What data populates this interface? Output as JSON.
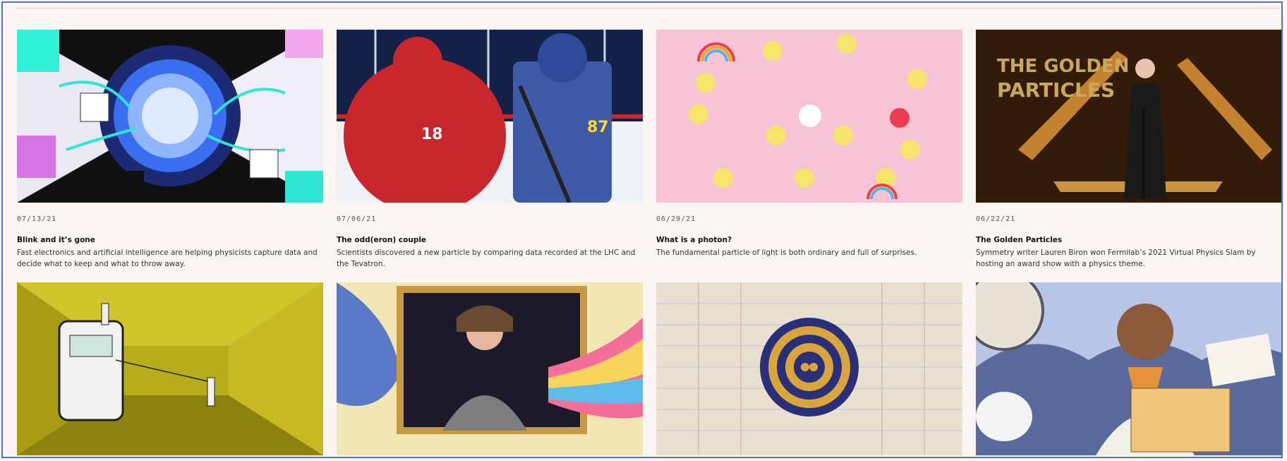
{
  "articles": [
    {
      "date": "07/13/21",
      "title": "Blink and it’s gone",
      "description": "Fast electronics and artificial intelligence are helping physicists capture data and decide what to keep and what to throw away."
    },
    {
      "date": "07/06/21",
      "title": "The odd(eron) couple",
      "description": "Scientists discovered a new particle by comparing data recorded at the LHC and the Tevatron."
    },
    {
      "date": "06/29/21",
      "title": "What is a photon?",
      "description": "The fundamental particle of light is both ordinary and full of surprises."
    },
    {
      "date": "06/22/21",
      "title": "The Golden Particles",
      "description": "Symmetry writer Lauren Biron won Fermilab’s 2021 Virtual Physics Slam by hosting an award show with a physics theme.",
      "image_text": "THE GOLDEN PARTICLES"
    },
    {
      "image": "radiation detector illustration"
    },
    {
      "image": "scientist in window illustration"
    },
    {
      "image": "handwritten ledger with target"
    },
    {
      "image": "reading man illustration"
    }
  ],
  "colors": {
    "background": "#fbf5f3",
    "frame": "#4a73c9"
  }
}
